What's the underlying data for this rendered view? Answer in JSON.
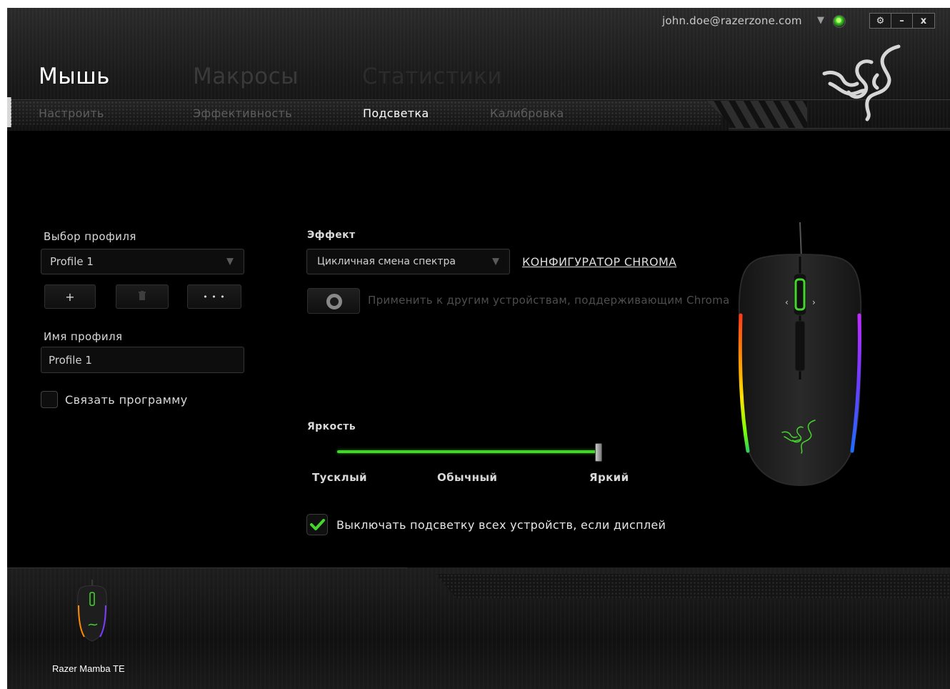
{
  "topbar": {
    "email": "john.doe@razerzone.com",
    "dropdown_glyph": "▼",
    "window_buttons": {
      "settings": "⚙",
      "minimize": "–",
      "close": "x"
    }
  },
  "main_tabs": [
    {
      "label": "Мышь",
      "active": true
    },
    {
      "label": "Макросы",
      "active": false
    },
    {
      "label": "Статистики",
      "active": false
    }
  ],
  "sub_tabs": [
    {
      "label": "Настроить",
      "active": false
    },
    {
      "label": "Эффективность",
      "active": false
    },
    {
      "label": "Подсветка",
      "active": true
    },
    {
      "label": "Калибровка",
      "active": false
    }
  ],
  "profile": {
    "select_label": "Выбор профиля",
    "selected": "Profile 1",
    "add_glyph": "+",
    "delete_glyph": "🗑",
    "more_glyph": "• • •",
    "name_label": "Имя профиля",
    "name_value": "Profile 1",
    "link_program_label": "Связать программу",
    "link_program_checked": false
  },
  "lighting": {
    "effect_label": "Эффект",
    "effect_value": "Цикличная смена спектра",
    "chroma_link": "КОНФИГУРАТОР CHROMA",
    "apply_label": "Применить к другим устройствам, поддерживающим Chroma",
    "apply_enabled": false,
    "brightness_label": "Яркость",
    "brightness_level": 1.0,
    "brightness_ticks": [
      "Тусклый",
      "Обычный",
      "Яркий"
    ],
    "dim_label": "Выключать подсветку всех устройств, если дисплей",
    "dim_checked": true
  },
  "footer": {
    "device_name": "Razer Mamba TE"
  },
  "colors": {
    "accent": "#44d62c",
    "background": "#000000",
    "text": "#d9d9d9"
  }
}
